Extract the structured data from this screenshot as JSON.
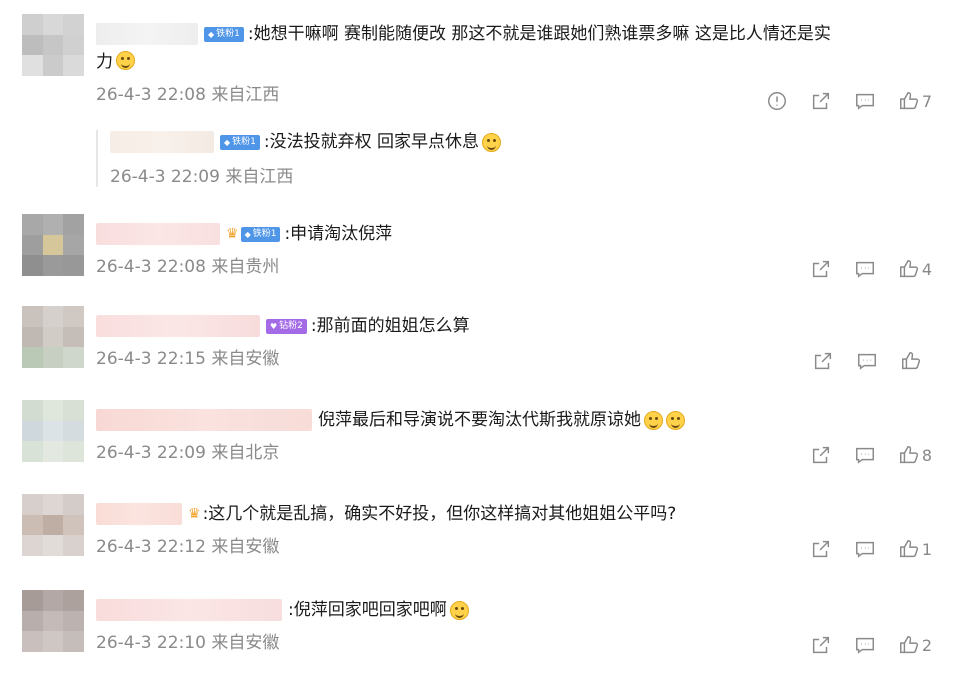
{
  "comments": [
    {
      "badge": "铁粉1",
      "badge_type": "iron",
      "text_line1": ":她想干嘛啊 赛制能随便改 那这不就是谁跟她们熟谁票多嘛 这是比人情还是实",
      "text_line2": "力",
      "emoji_line2": "smile",
      "time": "26-4-3 22:08 来自江西",
      "likes": "7",
      "has_report": true,
      "reply": {
        "badge": "铁粉1",
        "text": ":没法投就弃权 回家早点休息",
        "emoji": "smile",
        "time": "26-4-3 22:09 来自江西"
      }
    },
    {
      "badge": "铁粉1",
      "badge_type": "iron-crown",
      "text_line1": ":申请淘汰倪萍",
      "time": "26-4-3 22:08 来自贵州",
      "likes": "4"
    },
    {
      "badge": "钻粉2",
      "badge_type": "diamond",
      "text_line1": ":那前面的姐姐怎么算",
      "time": "26-4-3 22:15 来自安徽",
      "likes": ""
    },
    {
      "badge": "",
      "badge_type": "none",
      "text_line1": "倪萍最后和导演说不要淘汰代斯我就原谅她",
      "emoji_line1": "laugh-cry",
      "time": "26-4-3 22:09 来自北京",
      "likes": "8"
    },
    {
      "badge": "",
      "badge_type": "crown",
      "text_line1": ":这几个就是乱搞，确实不好投，但你这样搞对其他姐姐公平吗?",
      "time": "26-4-3 22:12 来自安徽",
      "likes": "1"
    },
    {
      "badge": "",
      "badge_type": "none",
      "text_line1": ":倪萍回家吧回家吧啊",
      "emoji_line1": "cry",
      "time": "26-4-3 22:10 来自安徽",
      "likes": "2"
    }
  ],
  "icons": {
    "report": "report-icon",
    "share": "share-icon",
    "comment": "comment-icon",
    "like": "like-icon"
  },
  "colors": {
    "badge_iron": "#4f95e8",
    "badge_diamond": "#a46be6",
    "meta_gray": "#8a8a8a"
  }
}
